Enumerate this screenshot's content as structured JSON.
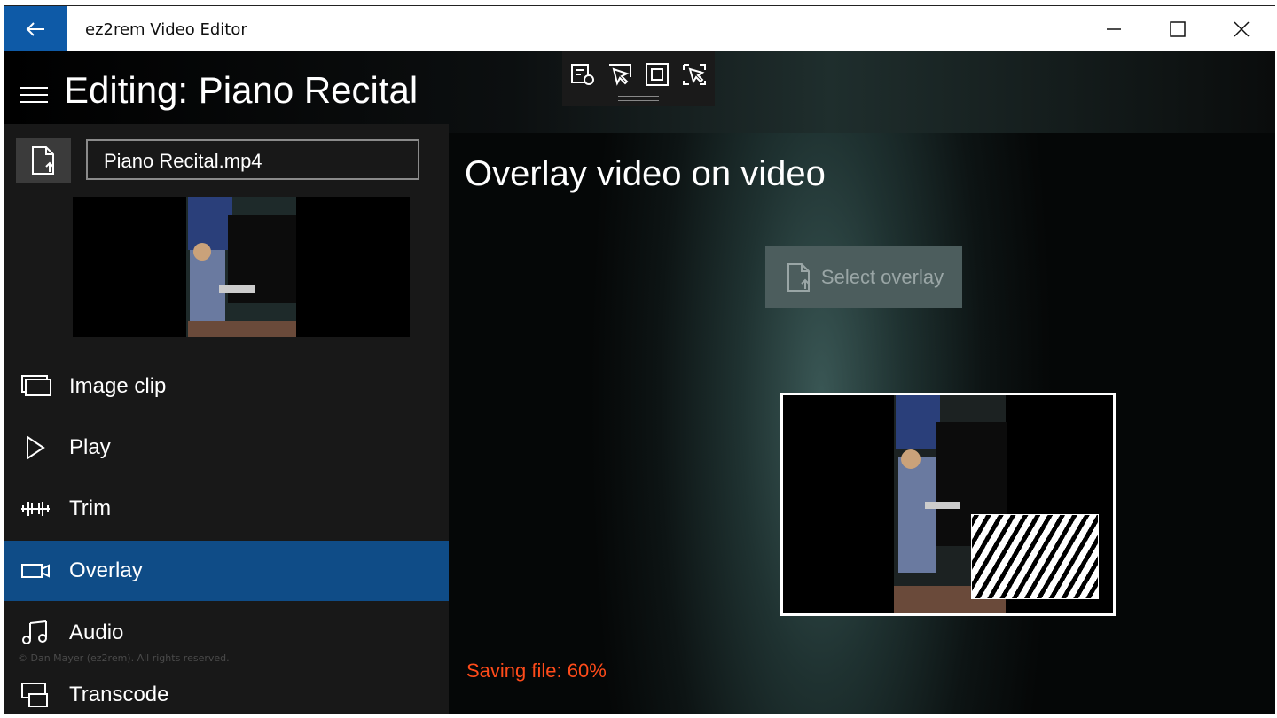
{
  "window": {
    "app_title": "ez2rem Video Editor",
    "controls": [
      "minimize",
      "maximize",
      "close"
    ]
  },
  "header": {
    "title": "Editing: Piano Recital"
  },
  "left": {
    "file_name": "Piano Recital.mp4",
    "nav": [
      {
        "label": "Image clip",
        "icon": "image-clip-icon"
      },
      {
        "label": "Play",
        "icon": "play-icon"
      },
      {
        "label": "Trim",
        "icon": "trim-icon"
      },
      {
        "label": "Overlay",
        "icon": "video-camera-icon",
        "active": true
      },
      {
        "label": "Audio",
        "icon": "music-note-icon"
      },
      {
        "label": "Transcode",
        "icon": "transcode-icon"
      }
    ],
    "copyright": "© Dan Mayer (ez2rem). All rights reserved."
  },
  "main": {
    "title": "Overlay video on video",
    "select_overlay": "Select overlay",
    "status": "Saving file: 60%"
  },
  "colors": {
    "accent": "#0f4c87",
    "status": "#ff4b1a",
    "back": "#0e5aa7"
  }
}
